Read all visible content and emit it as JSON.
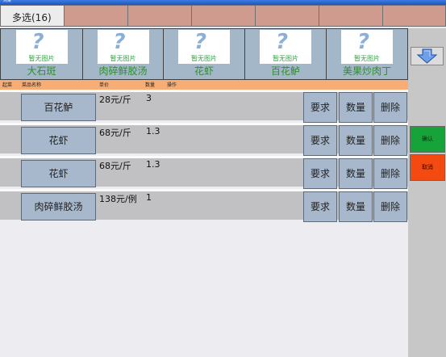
{
  "window": {
    "title": "点菜"
  },
  "tabs": [
    {
      "label": "多选(16)"
    },
    {
      "label": ""
    },
    {
      "label": ""
    },
    {
      "label": ""
    },
    {
      "label": ""
    },
    {
      "label": ""
    },
    {
      "label": ""
    }
  ],
  "dishes": [
    {
      "name": "大石斑",
      "placeholder": "暂无图片"
    },
    {
      "name": "肉碎鲜胶汤",
      "placeholder": "暂无图片"
    },
    {
      "name": "花虾",
      "placeholder": "暂无图片"
    },
    {
      "name": "百花鲈",
      "placeholder": "暂无图片"
    },
    {
      "name": "美果炒肉丁",
      "placeholder": "暂无图片"
    }
  ],
  "columns": {
    "start": "起菜",
    "name": "菜品名称",
    "price": "单价",
    "qty": "数量",
    "ops": "操作"
  },
  "orders": [
    {
      "name": "百花鲈",
      "price": "28元/斤",
      "qty": "3"
    },
    {
      "name": "花虾",
      "price": "68元/斤",
      "qty": "1.3"
    },
    {
      "name": "花虾",
      "price": "68元/斤",
      "qty": "1.3"
    },
    {
      "name": "肉碎鲜胶汤",
      "price": "138元/例",
      "qty": "1"
    }
  ],
  "row_actions": {
    "require": "要求",
    "quantity": "数量",
    "delete": "删除"
  },
  "side": {
    "confirm": "确认",
    "cancel": "取消",
    "scroll_icon": "arrow-down-icon"
  },
  "colors": {
    "tab": "#cf9b8f",
    "header_bar": "#f7ad74",
    "button": "#a7b8cc",
    "confirm": "#18a23a",
    "cancel": "#f24a10"
  }
}
